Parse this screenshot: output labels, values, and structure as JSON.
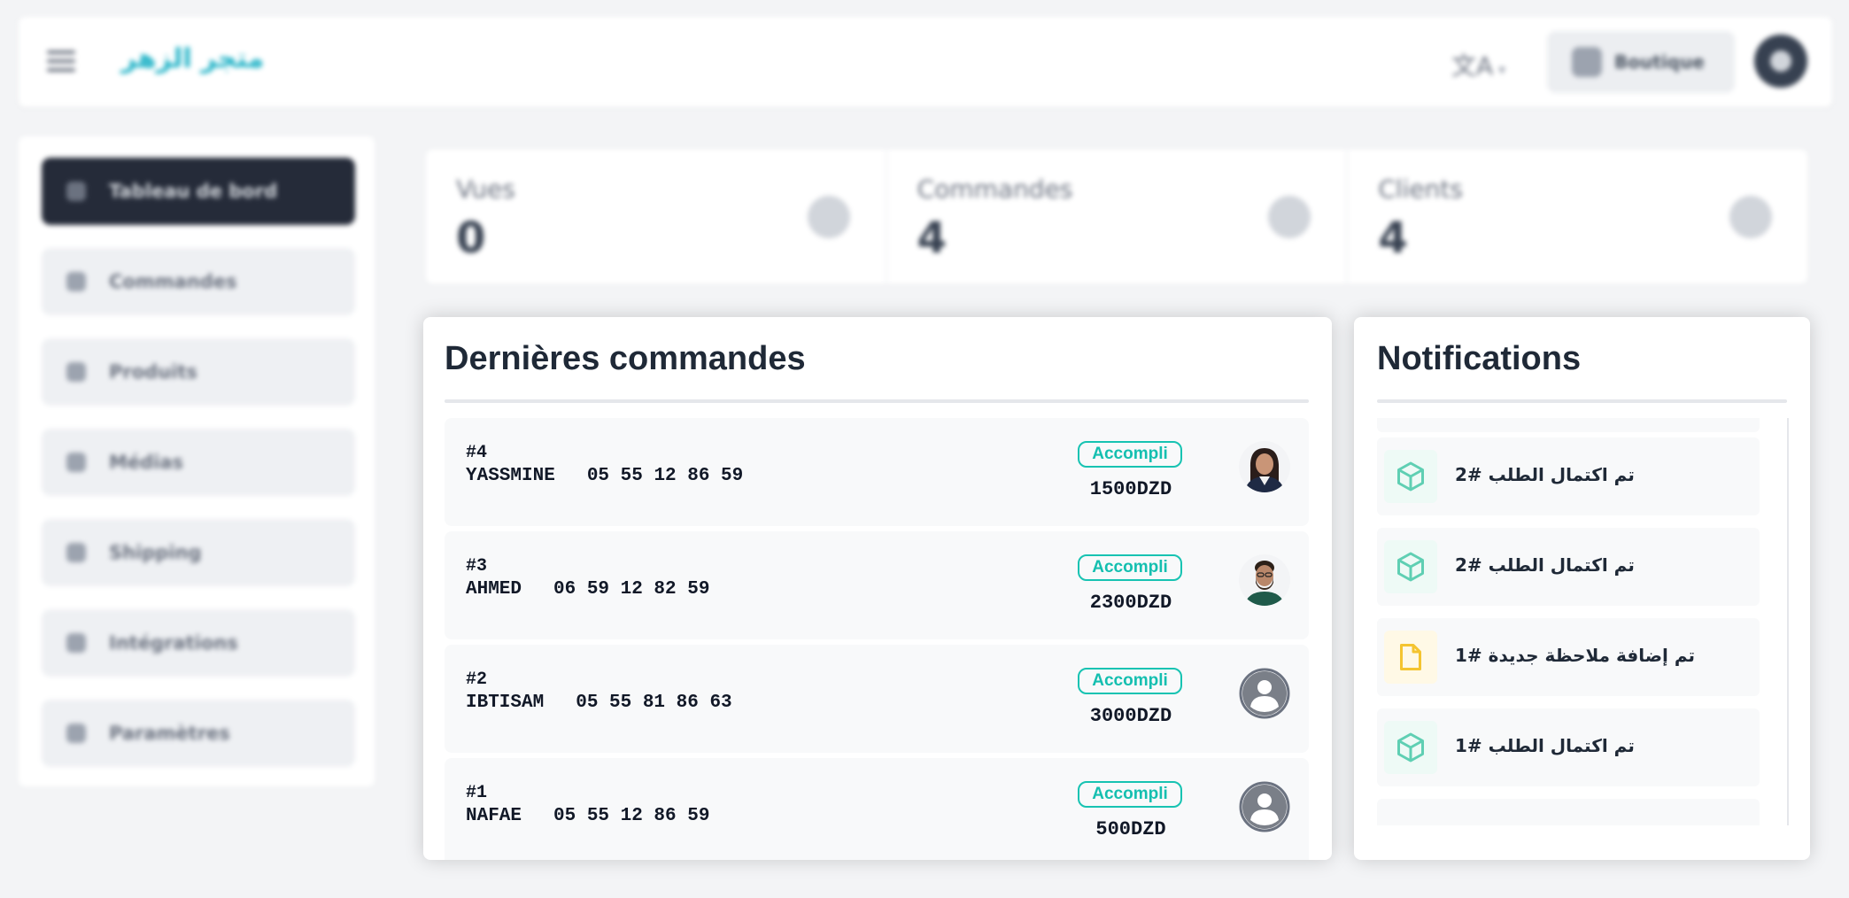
{
  "topbar": {
    "brand": "متجر الزهر",
    "lang_glyph": "文A",
    "shop_label": "Boutique"
  },
  "sidebar": {
    "items": [
      {
        "label": "Tableau de bord",
        "active": true
      },
      {
        "label": "Commandes"
      },
      {
        "label": "Produits"
      },
      {
        "label": "Médias"
      },
      {
        "label": "Shipping"
      },
      {
        "label": "Intégrations"
      },
      {
        "label": "Paramètres"
      }
    ]
  },
  "stats": [
    {
      "title": "Vues",
      "value": "0",
      "icon": "views-icon"
    },
    {
      "title": "Commandes",
      "value": "4",
      "icon": "orders-icon"
    },
    {
      "title": "Clients",
      "value": "4",
      "icon": "clients-icon"
    }
  ],
  "orders": {
    "title": "Dernières commandes",
    "rows": [
      {
        "num": "#4",
        "name": "YASSMINE",
        "phone": "05 55 12 86 59",
        "status": "Accompli",
        "amount": "1500DZD",
        "avatar": "woman-photo"
      },
      {
        "num": "#3",
        "name": "AHMED",
        "phone": "06 59 12 82 59",
        "status": "Accompli",
        "amount": "2300DZD",
        "avatar": "man-photo"
      },
      {
        "num": "#2",
        "name": "IBTISAM",
        "phone": "05 55 81 86 63",
        "status": "Accompli",
        "amount": "3000DZD",
        "avatar": "default-user"
      },
      {
        "num": "#1",
        "name": "NAFAE",
        "phone": "05 55 12 86 59",
        "status": "Accompli",
        "amount": "500DZD",
        "avatar": "default-user"
      }
    ]
  },
  "notifications": {
    "title": "Notifications",
    "items": [
      {
        "text": "تم اكتمال الطلب #2",
        "icon": "box-icon",
        "color": "#5fcfb3"
      },
      {
        "text": "تم اكتمال الطلب #2",
        "icon": "box-icon",
        "color": "#5fcfb3"
      },
      {
        "text": "تم إضافة ملاحظة جديدة #1",
        "icon": "note-icon",
        "color": "#f4c430"
      },
      {
        "text": "تم اكتمال الطلب #1",
        "icon": "box-icon",
        "color": "#5fcfb3"
      }
    ]
  },
  "colors": {
    "accent": "#17c3b2",
    "sidebar_active": "#252b39",
    "brand": "#22b3c7"
  }
}
